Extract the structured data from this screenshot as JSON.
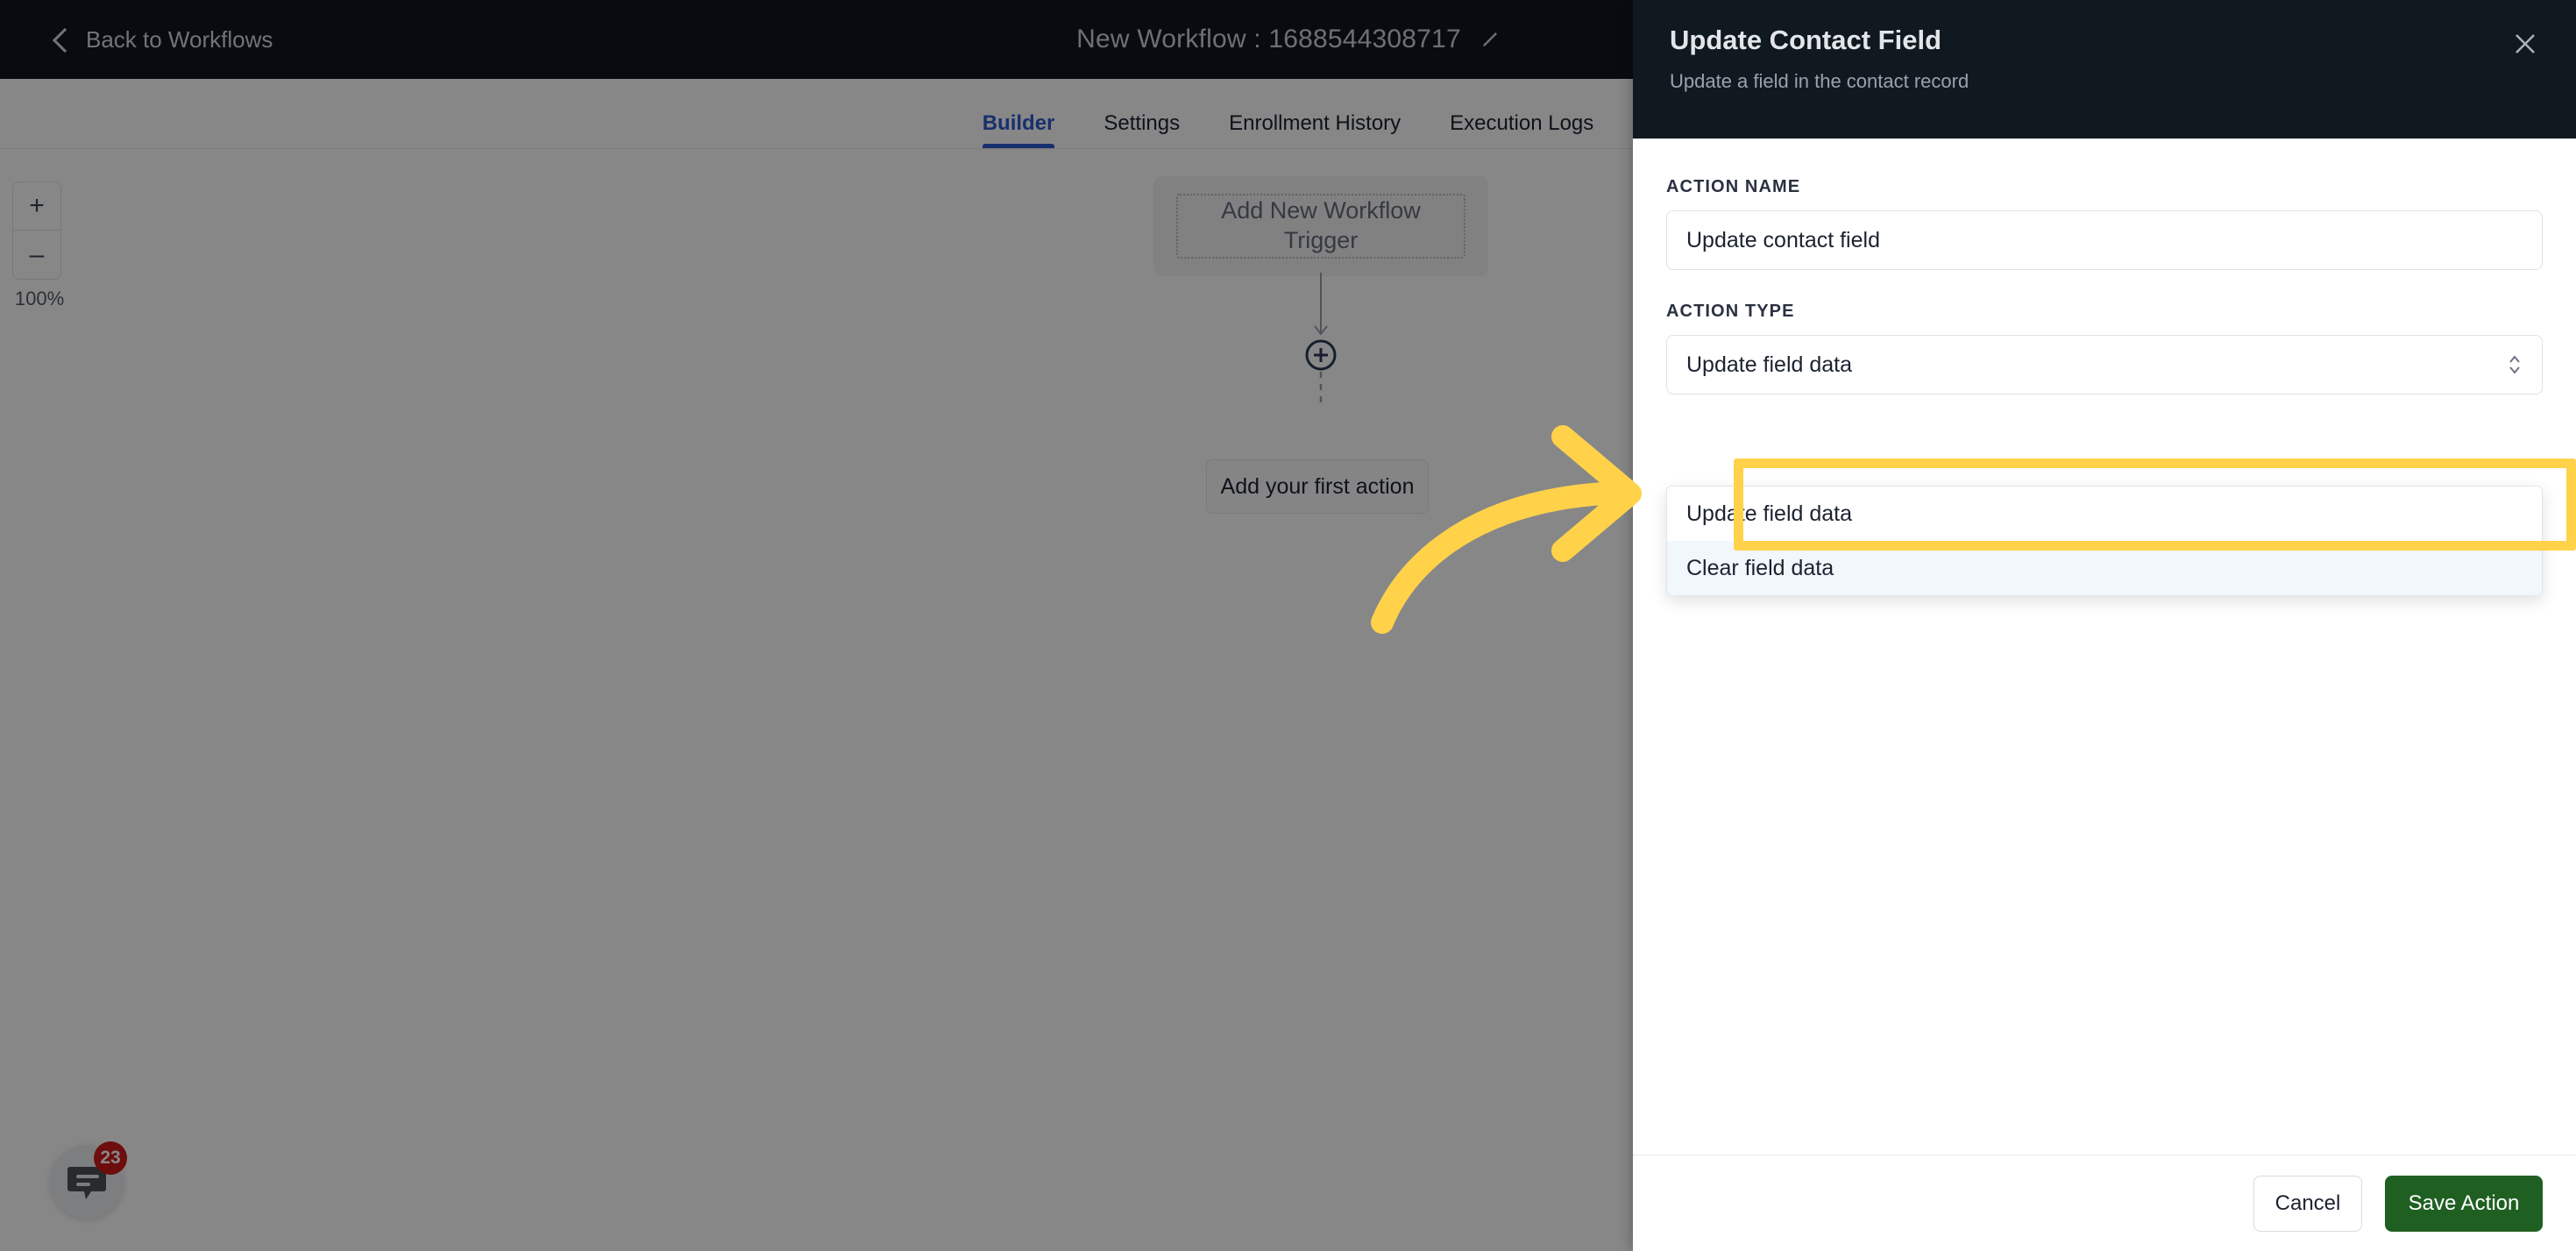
{
  "topbar": {
    "back_label": "Back to Workflows",
    "back_icon": "chevron-left-icon",
    "workflow_title": "New Workflow : 1688544308717",
    "edit_icon": "pencil-icon"
  },
  "tabs": [
    {
      "label": "Builder",
      "active": true
    },
    {
      "label": "Settings",
      "active": false
    },
    {
      "label": "Enrollment History",
      "active": false
    },
    {
      "label": "Execution Logs",
      "active": false
    }
  ],
  "canvas": {
    "zoom": {
      "plus_label": "+",
      "minus_label": "–",
      "level": "100%"
    },
    "trigger_node_label": "Add New Workflow Trigger",
    "add_node_icon": "plus-circle-icon",
    "first_action_label": "Add your first action",
    "chat_widget": {
      "icon": "chat-bubble-icon",
      "badge_count": "23"
    }
  },
  "panel": {
    "title": "Update Contact Field",
    "subtitle": "Update a field in the contact record",
    "close_icon": "close-icon",
    "action_name": {
      "label": "ACTION NAME",
      "value": "Update contact field",
      "placeholder": "Action name"
    },
    "action_type": {
      "label": "ACTION TYPE",
      "value": "Update field data",
      "caret_icon": "chevron-updown-icon",
      "options": [
        {
          "label": "Update field data",
          "highlighted": false
        },
        {
          "label": "Clear field data",
          "highlighted": true
        }
      ]
    },
    "footer": {
      "cancel_label": "Cancel",
      "save_label": "Save Action"
    }
  },
  "annotation": {
    "arrow_icon": "curved-arrow-icon",
    "highlight_color": "#ffd24a",
    "target": "Clear field data"
  },
  "colors": {
    "topbar_bg": "#101820",
    "accent_blue": "#2f5bd0",
    "save_green": "#1f6022",
    "badge_red": "#d0191a",
    "highlight_yellow": "#ffd24a"
  }
}
